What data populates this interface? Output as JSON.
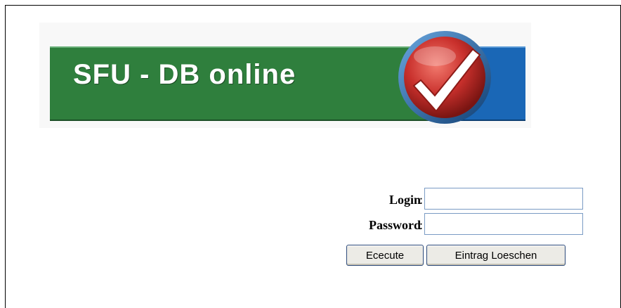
{
  "banner": {
    "title": "SFU - DB online",
    "logo_icon": "checkmark-badge-icon",
    "colors": {
      "green": "#2f7f3d",
      "blue": "#1a67b6",
      "badge_red": "#c9302c"
    }
  },
  "form": {
    "login_label": "Login",
    "password_label": "Password",
    "colon": ":",
    "login_value": "",
    "password_value": "",
    "execute_label": "Ececute",
    "clear_label": "Eintrag Loeschen"
  }
}
